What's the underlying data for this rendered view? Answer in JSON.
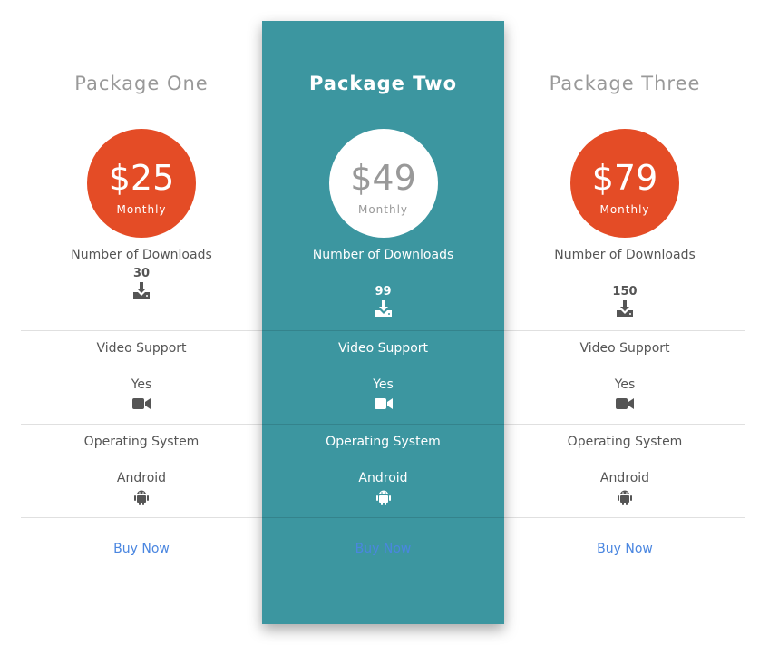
{
  "packages": [
    {
      "name": "Package One",
      "price": "$25",
      "period": "Monthly",
      "downloads_label": "Number of Downloads",
      "downloads_value": "30",
      "video_label": "Video Support",
      "video_value": "Yes",
      "os_label": "Operating System",
      "os_value": "Android",
      "buy_label": "Buy Now",
      "featured": false
    },
    {
      "name": "Package Two",
      "price": "$49",
      "period": "Monthly",
      "downloads_label": "Number of Downloads",
      "downloads_value": "99",
      "video_label": "Video Support",
      "video_value": "Yes",
      "os_label": "Operating System",
      "os_value": "Android",
      "buy_label": "Buy Now",
      "featured": true
    },
    {
      "name": "Package Three",
      "price": "$79",
      "period": "Monthly",
      "downloads_label": "Number of Downloads",
      "downloads_value": "150",
      "video_label": "Video Support",
      "video_value": "Yes",
      "os_label": "Operating System",
      "os_value": "Android",
      "buy_label": "Buy Now",
      "featured": false
    }
  ],
  "icons": {
    "downloads": "download-icon",
    "video": "video-camera-icon",
    "os": "android-icon"
  },
  "colors": {
    "accent_circle": "#e44c26",
    "featured_bg": "#3c96a0",
    "link": "#4a86e0"
  }
}
